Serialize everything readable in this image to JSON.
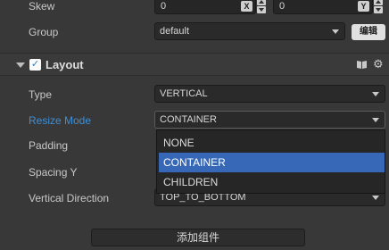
{
  "rows": {
    "skew": {
      "label": "Skew",
      "x_value": "0",
      "x_axis": "X",
      "y_value": "0",
      "y_axis": "Y"
    },
    "group": {
      "label": "Group",
      "value": "default",
      "edit_label": "编辑"
    }
  },
  "layout_component": {
    "title": "Layout",
    "enabled": true,
    "check_glyph": "✓",
    "icons": {
      "help": "book-icon",
      "settings": "gear-icon",
      "fold": "triangle-down-icon"
    },
    "fields": {
      "type": {
        "label": "Type",
        "value": "VERTICAL"
      },
      "resize_mode": {
        "label": "Resize Mode",
        "value": "CONTAINER"
      },
      "padding": {
        "label": "Padding"
      },
      "spacing_y": {
        "label": "Spacing Y"
      },
      "vertical_direction": {
        "label": "Vertical Direction",
        "value": "TOP_TO_BOTTOM"
      }
    },
    "resize_mode_options": [
      "NONE",
      "CONTAINER",
      "CHILDREN"
    ],
    "resize_mode_selected": "CONTAINER"
  },
  "add_component_label": "添加组件",
  "colors": {
    "background": "#383838",
    "active_label": "#3e8fd7",
    "selection": "#3768b8"
  }
}
